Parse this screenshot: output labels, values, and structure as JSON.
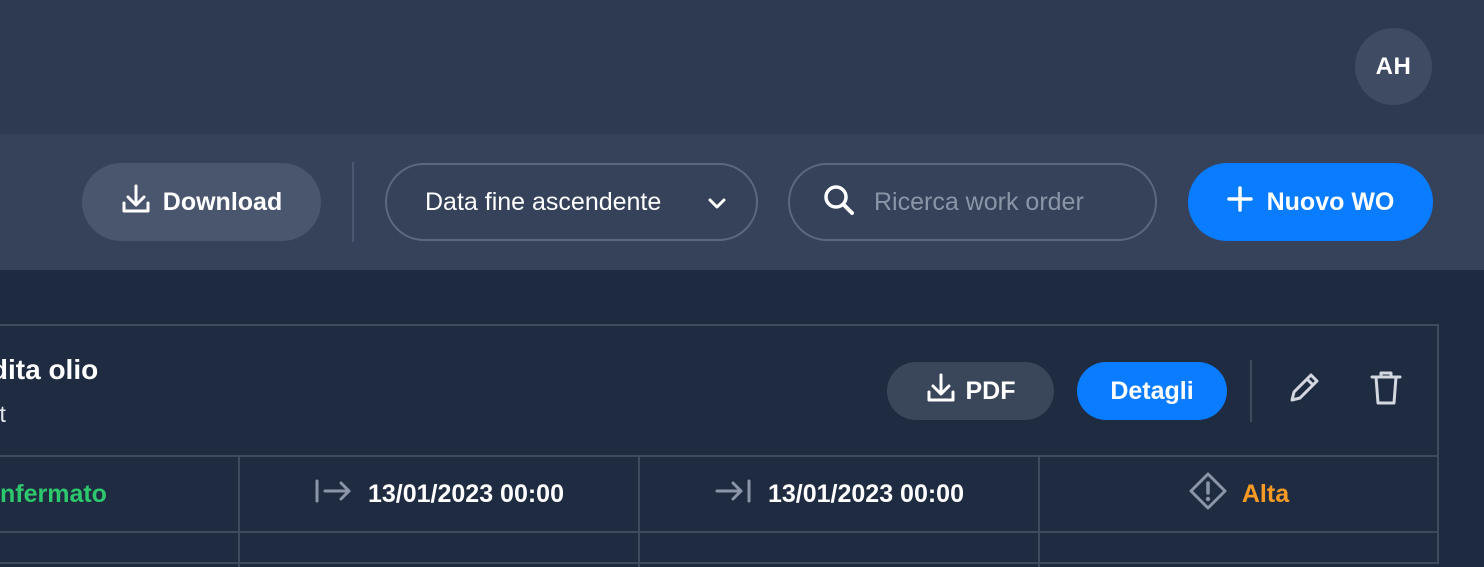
{
  "header": {
    "avatar_initials": "AH"
  },
  "toolbar": {
    "download_label": "Download",
    "sort_value": "Data fine ascendente",
    "search_placeholder": "Ricerca work order",
    "new_label": "Nuovo WO"
  },
  "work_order": {
    "title": "rdita olio",
    "subtitle": "st",
    "pdf_label": "PDF",
    "details_label": "Detagli",
    "status": "nfermato",
    "start_date": "13/01/2023 00:00",
    "end_date": "13/01/2023 00:00",
    "priority": "Alta"
  },
  "colors": {
    "accent": "#0a7cff",
    "status_confirmed": "#2dc76d",
    "priority_high": "#f59a23",
    "header_bg": "#2d3a51",
    "toolbar_bg": "#35425a",
    "page_bg": "#1e2a40"
  },
  "icons": {
    "download": "download-icon",
    "sort": "chevron-down-icon",
    "search": "search-icon",
    "add": "plus-icon",
    "pdf": "download-icon",
    "edit": "pencil-icon",
    "delete": "trash-icon",
    "start": "start-arrow-icon",
    "end": "end-arrow-icon",
    "priority": "priority-warning-icon"
  }
}
